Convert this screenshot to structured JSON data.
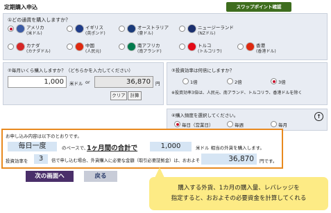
{
  "header": {
    "title": "定期購入申込",
    "swap_button": "スワップポイント確認"
  },
  "currency": {
    "question": "①どの通貨を購入しますか？",
    "selected": "usd",
    "items": [
      {
        "name": "アメリカ",
        "unit": "(米ドル)",
        "color": "#3b5ba5"
      },
      {
        "name": "イギリス",
        "unit": "(英ポンド)",
        "color": "#1f3c88"
      },
      {
        "name": "オーストラリア",
        "unit": "(豪ドル)",
        "color": "#1a3a7a"
      },
      {
        "name": "ニュージーランド",
        "unit": "(NZドル)",
        "color": "#1a2f6e"
      },
      {
        "name": "カナダ",
        "unit": "(カナダドル)",
        "color": "#d62828"
      },
      {
        "name": "中国",
        "unit": "(人民元)",
        "color": "#de2910"
      },
      {
        "name": "南アフリカ",
        "unit": "(南アランド)",
        "color": "#007a4d"
      },
      {
        "name": "トルコ",
        "unit": "(トルコリラ)",
        "color": "#e30a17"
      },
      {
        "name": "香港",
        "unit": "(香港ドル)",
        "color": "#de2910"
      }
    ]
  },
  "amount": {
    "question": "②毎月いくら購入しますか？（どちらかを入力してください）",
    "foreign_value": "1,000",
    "foreign_unit": "米ドル",
    "or_label": "or",
    "yen_value": "36,870",
    "yen_unit": "円",
    "clear_button": "クリア",
    "calc_button": "計算"
  },
  "leverage": {
    "question": "③投資効率は何倍にしますか？",
    "options": [
      "1倍",
      "2倍",
      "3倍"
    ],
    "selected": "3倍",
    "note": "※投資効率3倍は、人民元、南アランド、トルコリラ、香港ドルを除く"
  },
  "frequency": {
    "question": "④購入頻度を選択してください。",
    "options": [
      "毎日（営業日）",
      "毎週",
      "毎月"
    ],
    "selected": "毎日（営業日）"
  },
  "summary": {
    "intro": "お申し込み内容は以下のとおりです。",
    "freq_value": "毎日一度",
    "text1": "のペースで、",
    "total_label": "1ヶ月間の合計で",
    "amount_value": "1,000",
    "text2": "米ドル 相当の外貨を購入します。",
    "text3": "投資効率を",
    "leverage_value": "3",
    "text4": "倍で申し込む場合、外貨購入に必要な金額（取引必要証拠金）は、おおよそ",
    "yen_value": "36,870",
    "yen_unit": "円です。"
  },
  "nav": {
    "next_button": "次の画面へ",
    "back_button": "戻る"
  },
  "callout": {
    "line1": "購入する外貨、1カ月の購入量、レバレッジを",
    "line2": "指定すると、おおよその必要資金を計算してくれる"
  },
  "colors": {
    "accent_orange": "#e8891e",
    "next_button": "#4a2f6a",
    "back_button": "#c8ccd8"
  }
}
